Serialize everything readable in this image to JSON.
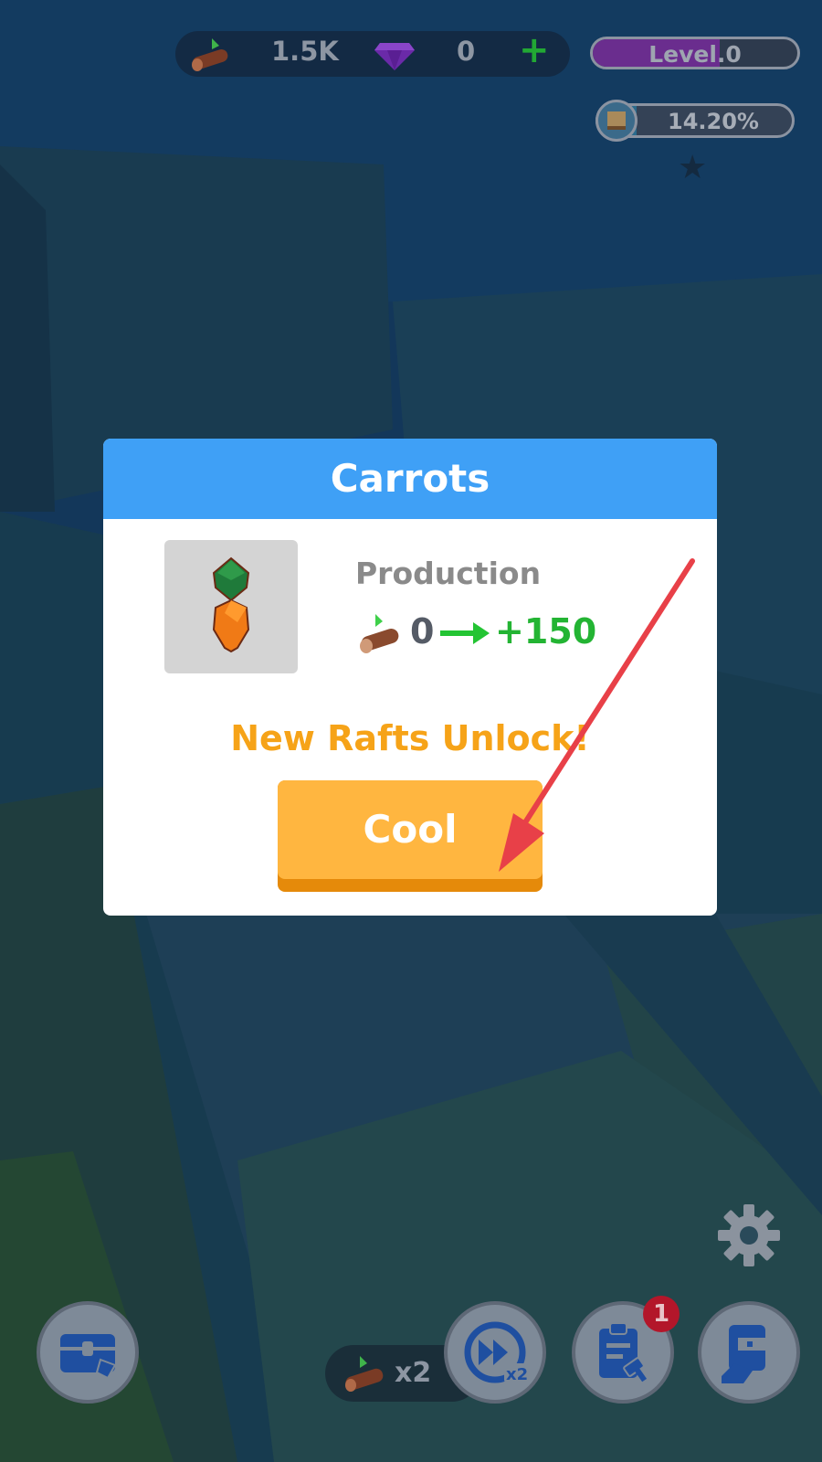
{
  "hud": {
    "wood": "1.5K",
    "gems": "0",
    "add_symbol": "+",
    "level": "Level.0",
    "progress_text": "14.20%",
    "progress_fraction": 0.142
  },
  "modal": {
    "title": "Carrots",
    "production_label": "Production",
    "production_from": "0",
    "production_to": "+150",
    "unlock_text": "New Rafts Unlock!",
    "button_label": "Cool"
  },
  "bottom": {
    "boost_multiplier": "x2",
    "fast_forward_multiplier": "x2",
    "tasks_badge": "1"
  },
  "colors": {
    "header_blue": "#3fa0f6",
    "button_orange": "#ffb640",
    "unlock_orange": "#f6a318",
    "gain_green": "#23b433",
    "badge_red": "#b3162a"
  }
}
